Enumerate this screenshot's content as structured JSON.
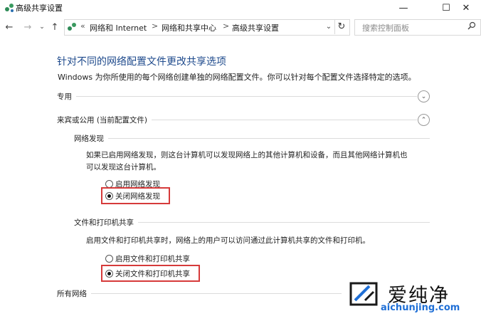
{
  "window": {
    "title": "高级共享设置",
    "controls": {
      "minimize": "—",
      "maximize": "☐",
      "close": "✕"
    }
  },
  "nav": {
    "back": "←",
    "forward": "→",
    "recent": "⌄",
    "up": "↑"
  },
  "address": {
    "overflow": "«",
    "breadcrumbs": [
      "网络和 Internet",
      "网络和共享中心",
      "高级共享设置"
    ],
    "separator": ">",
    "dropdown": "⌄",
    "refresh": "↻"
  },
  "search": {
    "placeholder": "搜索控制面板",
    "icon": "search-icon"
  },
  "content": {
    "title": "针对不同的网络配置文件更改共享选项",
    "description": "Windows 为你所使用的每个网络创建单独的网络配置文件。你可以针对每个配置文件选择特定的选项。",
    "profiles": [
      {
        "label": "专用",
        "expanded": false,
        "chevron": "⌄"
      },
      {
        "label": "来宾或公用 (当前配置文件)",
        "expanded": true,
        "chevron": "⌃"
      },
      {
        "label": "所有网络"
      }
    ],
    "network_discovery": {
      "heading": "网络发现",
      "text_line1": "如果已启用网络发现，则这台计算机可以发现网络上的其他计算机和设备，而且其他网络计算机也",
      "text_line2": "可以发现这台计算机。",
      "options": [
        {
          "label": "启用网络发现",
          "selected": false
        },
        {
          "label": "关闭网络发现",
          "selected": true
        }
      ]
    },
    "file_printer_sharing": {
      "heading": "文件和打印机共享",
      "text": "启用文件和打印机共享时，网络上的用户可以访问通过此计算机共享的文件和打印机。",
      "options": [
        {
          "label": "启用文件和打印机共享",
          "selected": false
        },
        {
          "label": "关闭文件和打印机共享",
          "selected": true
        }
      ]
    }
  },
  "colors": {
    "title_blue": "#1e4a8c",
    "highlight_red": "#d63a3a",
    "watermark_url": "#1f6fd6"
  },
  "watermark": {
    "name": "爱纯净",
    "url": "aichunjing.com"
  }
}
